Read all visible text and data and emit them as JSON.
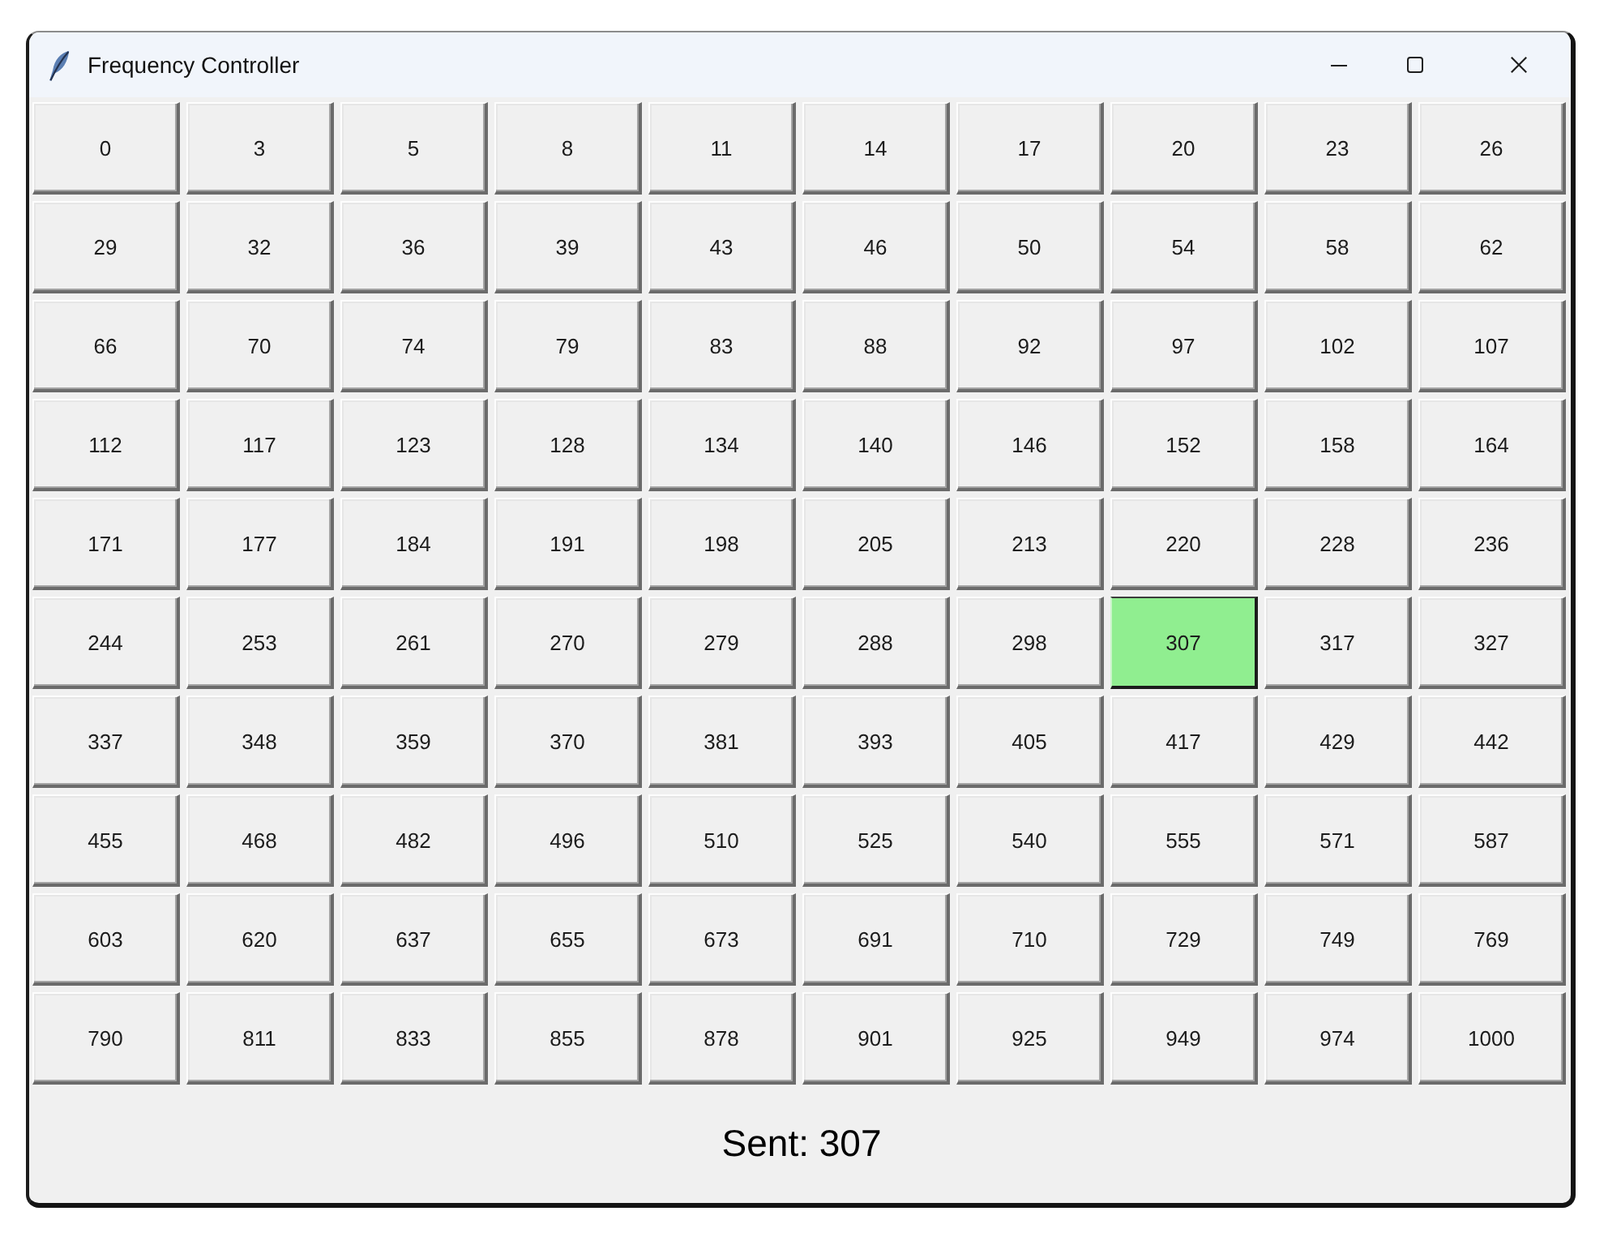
{
  "window": {
    "title": "Frequency Controller"
  },
  "buttons": [
    {
      "label": "0",
      "selected": false
    },
    {
      "label": "3",
      "selected": false
    },
    {
      "label": "5",
      "selected": false
    },
    {
      "label": "8",
      "selected": false
    },
    {
      "label": "11",
      "selected": false
    },
    {
      "label": "14",
      "selected": false
    },
    {
      "label": "17",
      "selected": false
    },
    {
      "label": "20",
      "selected": false
    },
    {
      "label": "23",
      "selected": false
    },
    {
      "label": "26",
      "selected": false
    },
    {
      "label": "29",
      "selected": false
    },
    {
      "label": "32",
      "selected": false
    },
    {
      "label": "36",
      "selected": false
    },
    {
      "label": "39",
      "selected": false
    },
    {
      "label": "43",
      "selected": false
    },
    {
      "label": "46",
      "selected": false
    },
    {
      "label": "50",
      "selected": false
    },
    {
      "label": "54",
      "selected": false
    },
    {
      "label": "58",
      "selected": false
    },
    {
      "label": "62",
      "selected": false
    },
    {
      "label": "66",
      "selected": false
    },
    {
      "label": "70",
      "selected": false
    },
    {
      "label": "74",
      "selected": false
    },
    {
      "label": "79",
      "selected": false
    },
    {
      "label": "83",
      "selected": false
    },
    {
      "label": "88",
      "selected": false
    },
    {
      "label": "92",
      "selected": false
    },
    {
      "label": "97",
      "selected": false
    },
    {
      "label": "102",
      "selected": false
    },
    {
      "label": "107",
      "selected": false
    },
    {
      "label": "112",
      "selected": false
    },
    {
      "label": "117",
      "selected": false
    },
    {
      "label": "123",
      "selected": false
    },
    {
      "label": "128",
      "selected": false
    },
    {
      "label": "134",
      "selected": false
    },
    {
      "label": "140",
      "selected": false
    },
    {
      "label": "146",
      "selected": false
    },
    {
      "label": "152",
      "selected": false
    },
    {
      "label": "158",
      "selected": false
    },
    {
      "label": "164",
      "selected": false
    },
    {
      "label": "171",
      "selected": false
    },
    {
      "label": "177",
      "selected": false
    },
    {
      "label": "184",
      "selected": false
    },
    {
      "label": "191",
      "selected": false
    },
    {
      "label": "198",
      "selected": false
    },
    {
      "label": "205",
      "selected": false
    },
    {
      "label": "213",
      "selected": false
    },
    {
      "label": "220",
      "selected": false
    },
    {
      "label": "228",
      "selected": false
    },
    {
      "label": "236",
      "selected": false
    },
    {
      "label": "244",
      "selected": false
    },
    {
      "label": "253",
      "selected": false
    },
    {
      "label": "261",
      "selected": false
    },
    {
      "label": "270",
      "selected": false
    },
    {
      "label": "279",
      "selected": false
    },
    {
      "label": "288",
      "selected": false
    },
    {
      "label": "298",
      "selected": false
    },
    {
      "label": "307",
      "selected": true
    },
    {
      "label": "317",
      "selected": false
    },
    {
      "label": "327",
      "selected": false
    },
    {
      "label": "337",
      "selected": false
    },
    {
      "label": "348",
      "selected": false
    },
    {
      "label": "359",
      "selected": false
    },
    {
      "label": "370",
      "selected": false
    },
    {
      "label": "381",
      "selected": false
    },
    {
      "label": "393",
      "selected": false
    },
    {
      "label": "405",
      "selected": false
    },
    {
      "label": "417",
      "selected": false
    },
    {
      "label": "429",
      "selected": false
    },
    {
      "label": "442",
      "selected": false
    },
    {
      "label": "455",
      "selected": false
    },
    {
      "label": "468",
      "selected": false
    },
    {
      "label": "482",
      "selected": false
    },
    {
      "label": "496",
      "selected": false
    },
    {
      "label": "510",
      "selected": false
    },
    {
      "label": "525",
      "selected": false
    },
    {
      "label": "540",
      "selected": false
    },
    {
      "label": "555",
      "selected": false
    },
    {
      "label": "571",
      "selected": false
    },
    {
      "label": "587",
      "selected": false
    },
    {
      "label": "603",
      "selected": false
    },
    {
      "label": "620",
      "selected": false
    },
    {
      "label": "637",
      "selected": false
    },
    {
      "label": "655",
      "selected": false
    },
    {
      "label": "673",
      "selected": false
    },
    {
      "label": "691",
      "selected": false
    },
    {
      "label": "710",
      "selected": false
    },
    {
      "label": "729",
      "selected": false
    },
    {
      "label": "749",
      "selected": false
    },
    {
      "label": "769",
      "selected": false
    },
    {
      "label": "790",
      "selected": false
    },
    {
      "label": "811",
      "selected": false
    },
    {
      "label": "833",
      "selected": false
    },
    {
      "label": "855",
      "selected": false
    },
    {
      "label": "878",
      "selected": false
    },
    {
      "label": "901",
      "selected": false
    },
    {
      "label": "925",
      "selected": false
    },
    {
      "label": "949",
      "selected": false
    },
    {
      "label": "974",
      "selected": false
    },
    {
      "label": "1000",
      "selected": false
    }
  ],
  "status": {
    "text": "Sent: 307"
  }
}
